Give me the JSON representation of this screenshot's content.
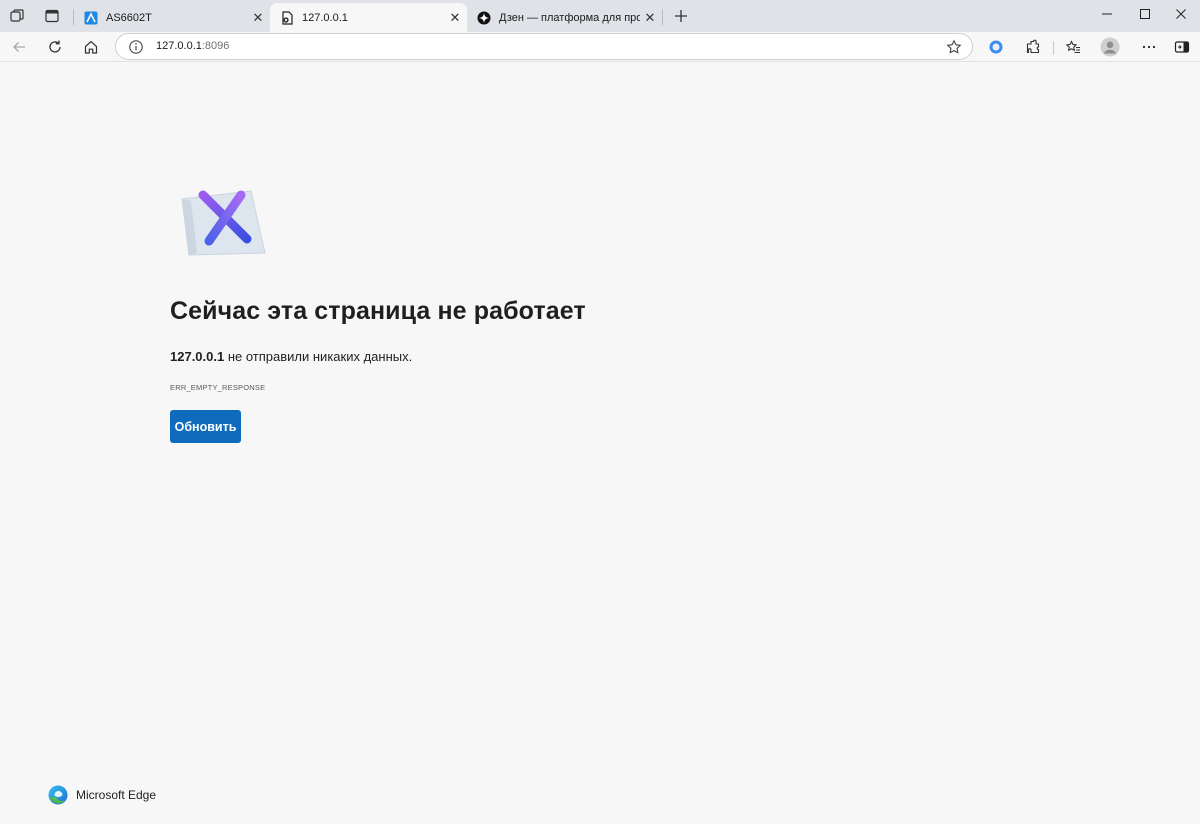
{
  "tabs": [
    {
      "title": "AS6602T",
      "favicon": "asustor-icon"
    },
    {
      "title": "127.0.0.1",
      "favicon": "page-error-icon"
    },
    {
      "title": "Дзен — платформа для просмот",
      "favicon": "dzen-icon"
    }
  ],
  "tab_close_glyph": "✕",
  "address": {
    "host": "127.0.0.1",
    "port": ":8096"
  },
  "error": {
    "title": "Сейчас эта страница не работает",
    "host": "127.0.0.1",
    "message": " не отправили никаких данных.",
    "code": "ERR_EMPTY_RESPONSE",
    "reload_label": "Обновить"
  },
  "brand": {
    "name": "Microsoft Edge"
  },
  "colors": {
    "accent": "#0f6cbd",
    "tabstrip": "#dfe3e8",
    "page_bg": "#f7f7f7"
  }
}
